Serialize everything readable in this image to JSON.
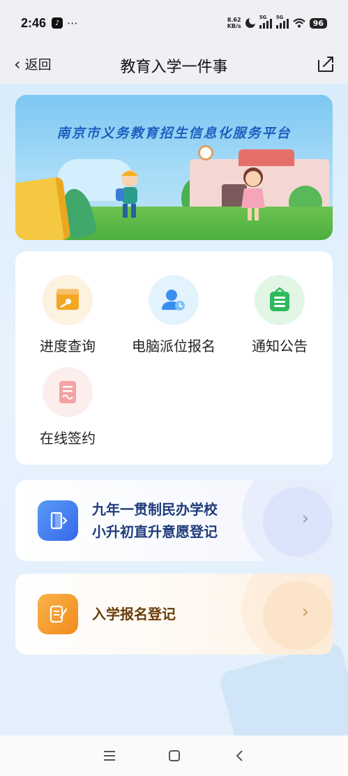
{
  "status_bar": {
    "time": "2:46",
    "more": "···",
    "net_speed_value": "8.62",
    "net_speed_unit": "KB/s",
    "signal1_label": "5G",
    "signal2_label": "5G",
    "battery": "96"
  },
  "nav": {
    "back_label": "返回",
    "title": "教育入学一件事"
  },
  "banner": {
    "title": "南京市义务教育招生信息化服务平台"
  },
  "services": [
    {
      "label": "进度查询",
      "icon": "progress-query-icon",
      "color": "#f5a623",
      "bg": "#fff3e0"
    },
    {
      "label": "电脑派位报名",
      "icon": "computer-assignment-icon",
      "color": "#3a8ef0",
      "bg": "#e6f4fd"
    },
    {
      "label": "通知公告",
      "icon": "notice-icon",
      "color": "#2fba5c",
      "bg": "#e3f7e8"
    },
    {
      "label": "在线签约",
      "icon": "online-sign-icon",
      "color": "#f07c7c",
      "bg": "#fdeeee"
    }
  ],
  "links": [
    {
      "line1": "九年一贯制民办学校",
      "line2": "小升初直升意愿登记",
      "color": "#1f3c7a",
      "accent": "#3d7bf0"
    },
    {
      "line1": "入学报名登记",
      "color": "#6b3d0c",
      "accent": "#f59a23"
    }
  ],
  "colors": {
    "primary_blue": "#3d7bf0",
    "orange": "#f59a23"
  }
}
